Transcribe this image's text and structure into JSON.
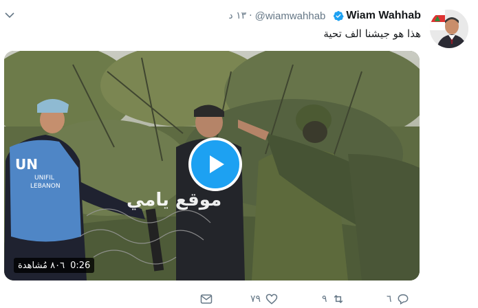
{
  "tweet": {
    "author_name": "Wiam Wahhab",
    "handle": "@wiamwahhab",
    "separator": "·",
    "time": "١٣ د",
    "text": "هذا هو جيشنا الف تحية"
  },
  "video": {
    "watermark": "موقع يامي",
    "vest_text_line1": "UN",
    "vest_text_line2": "UNIFIL",
    "vest_text_line3": "LEBANON",
    "duration": "0:26",
    "views": "٨٠٦ مُشاهدة"
  },
  "actions": {
    "reply_count": "٦",
    "retweet_count": "٩",
    "like_count": "٧٩"
  },
  "icons": {
    "verified": "verified-badge-icon",
    "chevron": "chevron-down-icon",
    "play": "play-icon",
    "reply": "reply-icon",
    "retweet": "retweet-icon",
    "like": "heart-icon",
    "message": "envelope-icon"
  },
  "colors": {
    "accent": "#1da1f2",
    "text": "#14171a",
    "secondary": "#657786",
    "vest": "#4f86c6"
  }
}
